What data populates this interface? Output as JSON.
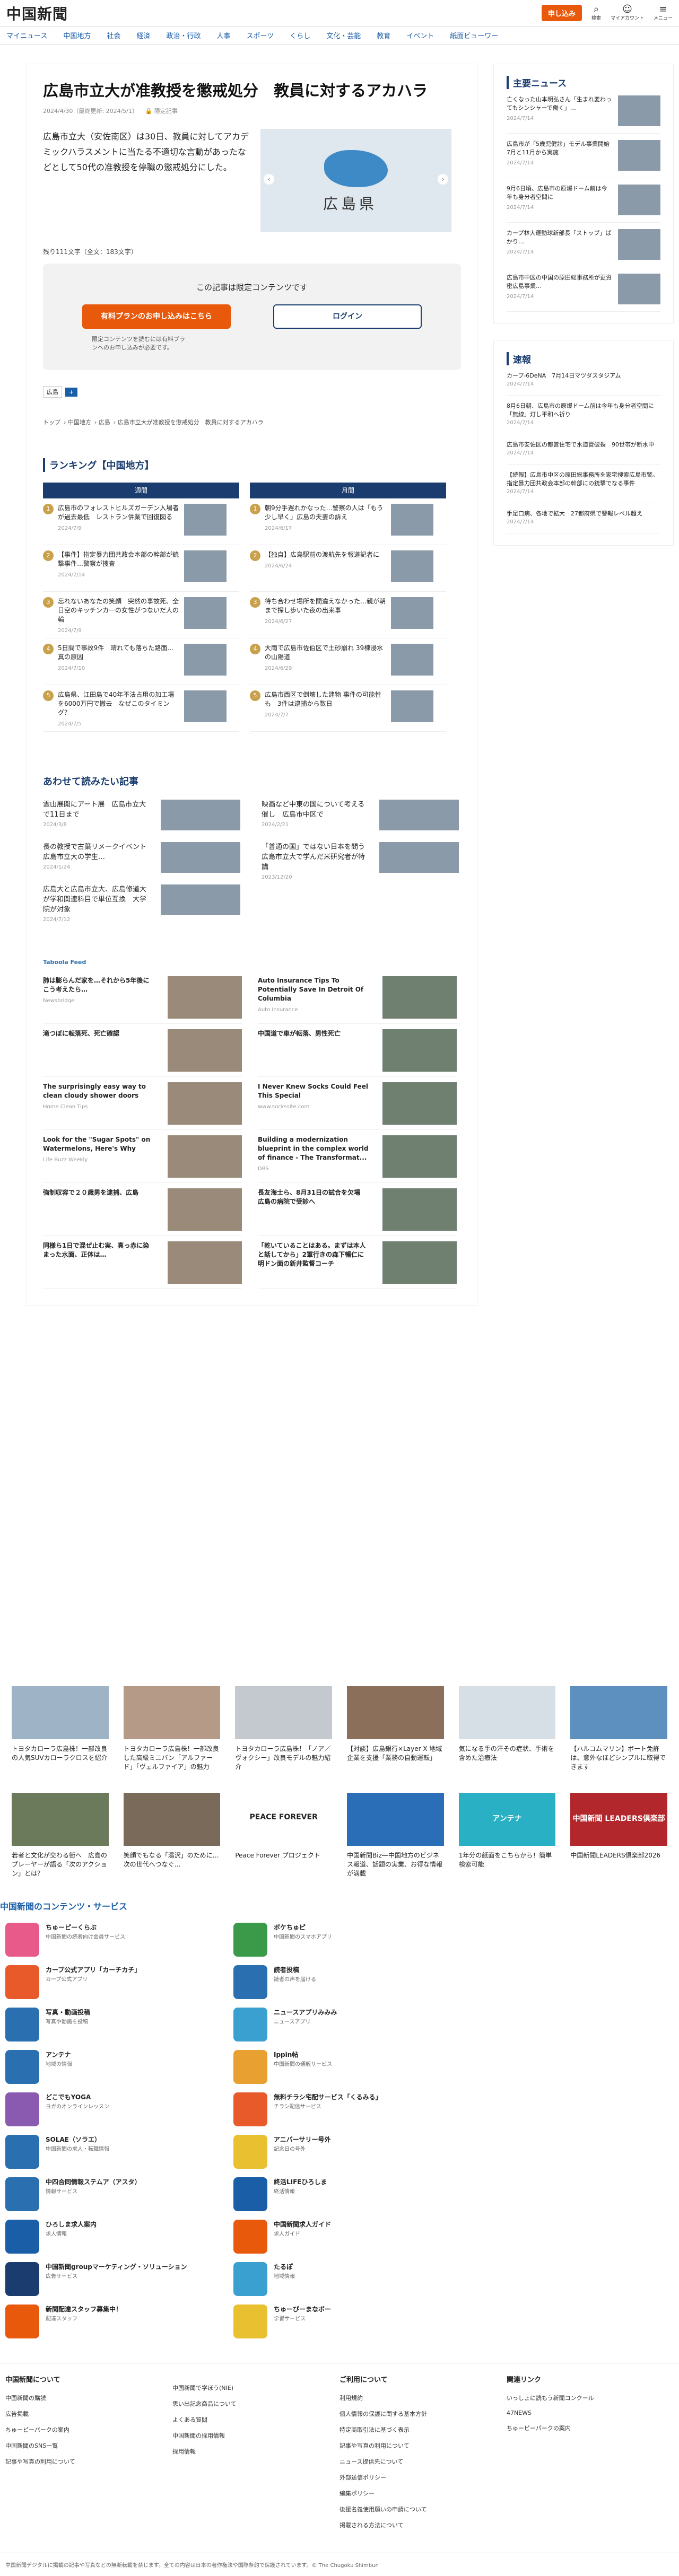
{
  "header": {
    "logo": "中国新聞",
    "signup": "申し込み",
    "search": "検索",
    "account": "マイアカウント",
    "menu": "メニュー"
  },
  "nav": [
    "マイニュース",
    "中国地方",
    "社会",
    "経済",
    "政治・行政",
    "人事",
    "スポーツ",
    "くらし",
    "文化・芸能",
    "教育",
    "イベント",
    "紙面ビューワー"
  ],
  "article": {
    "title": "広島市立大が准教授を懲戒処分　教員に対するアカハラ",
    "date": "2024/4/30（最終更新: 2024/5/1）",
    "limited": "限定記事",
    "lead": "広島市立大（安佐南区）は30日、教員に対してアカデミックハラスメントに当たる不適切な言動があったなどとして50代の准教授を停職の懲戒処分にした。",
    "map_label": "広島県",
    "chars": "残り111文字（全文：183文字）",
    "limited_heading": "この記事は限定コンテンツです",
    "plan_button": "有料プランのお申し込みはこちら",
    "login_button": "ログイン",
    "note": "限定コンテンツを読むには有料プランへのお申し込みが必要です。",
    "tag": "広島",
    "breadcrumb": [
      "トップ",
      "中国地方",
      "広島",
      "広島市立大が准教授を懲戒処分　教員に対するアカハラ"
    ]
  },
  "ranking": {
    "title": "ランキング【中国地方】",
    "weekly": "週間",
    "monthly": "月間",
    "weekly_items": [
      {
        "t": "広島市のフォレストヒルズガーデン入場者が過去最低　レストラン併業で回復図る",
        "d": "2024/7/9"
      },
      {
        "t": "【事件】指定暴力団共政会本部の幹部が銃撃事件…警察が捜査",
        "d": "2024/7/14"
      },
      {
        "t": "忘れないあなたの笑顔　突然の事故死、全日空のキッチンカーの女性がつないだ人の輪",
        "d": "2024/7/9"
      },
      {
        "t": "5日間で事故9件　晴れても落ちた路面…真の原因",
        "d": "2024/7/10"
      },
      {
        "t": "広島県、江田島で40年不法占用の加工場を6000万円で撤去　なぜこのタイミング？",
        "d": "2024/7/5"
      }
    ],
    "monthly_items": [
      {
        "t": "朝9分手遅れかなった…警察の人は「もう少し早く」広島の夫妻の訴え",
        "d": "2024/6/17"
      },
      {
        "t": "【独自】広島駅前の渡航先を報道記者に",
        "d": "2024/6/24"
      },
      {
        "t": "待ち合わせ場所を間違えなかった…親が朝まで探し歩いた夜の出来事",
        "d": "2024/6/27"
      },
      {
        "t": "大雨で広島市佐伯区で土砂崩れ 39棟浸水の山陽道",
        "d": "2024/6/29"
      },
      {
        "t": "広島市西区で倒壊した建物 事件の可能性も　3件は逮捕から数日",
        "d": "2024/7/7"
      }
    ]
  },
  "related": {
    "title": "あわせて読みたい記事",
    "items": [
      {
        "t": "霊山展開にアート展　広島市立大で11日まで",
        "d": "2024/3/8"
      },
      {
        "t": "映画など中東の国について考える催し　広島市中区で",
        "d": "2024/2/21"
      },
      {
        "t": "長の教授で古葉リメークイベント広島市立大の学生…",
        "d": "2024/1/24"
      },
      {
        "t": "「普通の国」ではない日本を問う　広島市立大で学んだ米研究者が特講",
        "d": "2023/12/20"
      },
      {
        "t": "広島大と広島市立大、広島修道大が学和関連科目で単位互換　大学院が対象",
        "d": "2024/7/12"
      }
    ]
  },
  "taboola": {
    "logo": "Taboola Feed",
    "items": [
      {
        "t": "肺は膨らんだ家を…それから5年後にこう考えたら…",
        "s": "Newsbridge"
      },
      {
        "t": "Auto Insurance Tips To Potentially Save In Detroit Of Columbia",
        "s": "Auto Insurance"
      },
      {
        "t": "滝つぼに転落死、死亡確認",
        "s": ""
      },
      {
        "t": "中国道で車が転落、男性死亡",
        "s": ""
      },
      {
        "t": "The surprisingly easy way to clean cloudy shower doors",
        "s": "Home Clean Tips"
      },
      {
        "t": "I Never Knew Socks Could Feel This Special",
        "s": "www.sockssite.com"
      },
      {
        "t": "Look for the \"Sugar Spots\" on Watermelons, Here's Why",
        "s": "Life Buzz Weekly"
      },
      {
        "t": "Building a modernization blueprint in the complex world of finance - The Transformat...",
        "s": "DBS"
      },
      {
        "t": "強制収容で２０歳男を逮捕、広島",
        "s": ""
      },
      {
        "t": "長友海士ら、8月31日の試合を欠場　広島の病院で受診へ",
        "s": ""
      },
      {
        "t": "同様ら1日で混ぜ止む実、真っ赤に染まった水面、正体は…",
        "s": ""
      },
      {
        "t": "「乾いていることはある。まずは本人と話してから」2軍行きの森下暢仁に明ドン面の新井監督コーチ",
        "s": ""
      }
    ]
  },
  "side": {
    "main_news_title": "主要ニュース",
    "main_news": [
      {
        "t": "亡くなった山本明弘さん「生まれ変わってもシンシャーで働く」…",
        "d": "2024/7/14"
      },
      {
        "t": "広島市が「5歳児健診」モデル事業開始　7月と11月から実施",
        "d": "2024/7/14"
      },
      {
        "t": "9月6日頃、広島市の原爆ドーム前は今年も身分者空間に　",
        "d": "2024/7/14"
      },
      {
        "t": "カープ林大運動球新部長「ストップ」ばかり…",
        "d": "2024/7/14"
      },
      {
        "t": "広島市中区の中国の原田総事務所が更資密広島事業…",
        "d": "2024/7/14"
      }
    ],
    "flash_title": "速報",
    "flash": [
      {
        "t": "カープ-6DeNA　7月14日マツダスタジアム",
        "d": "2024/7/14"
      },
      {
        "t": "8月6日朝、広島市の原爆ドーム前は今年も身分者空間に「無線」灯し平和へ祈り",
        "d": "2024/7/14"
      },
      {
        "t": "広島市安佐区の都営住宅で水道管破裂　90世帯が断水中",
        "d": "2024/7/14"
      },
      {
        "t": "【続報】広島市中区の原田総事務所を家宅捜索広島市警。指定暴力団共政会本部の幹部にの銃撃でなる事件",
        "d": "2024/7/14"
      },
      {
        "t": "手足口病、各地で拡大　27都府県で警報レベル超え",
        "d": "2024/7/14"
      }
    ]
  },
  "banners": [
    {
      "t": "トヨタカローラ広島株！一部改良の人気SUVカローラクロスを紹介"
    },
    {
      "t": "トヨタカローラ広島株！一部改良した高級ミニバン「アルファード」「ヴェルファイア」の魅力"
    },
    {
      "t": "トヨタカローラ広島株！「ノア／ヴォクシー」改良モデルの魅力紹介"
    },
    {
      "t": "【対談】広島銀行×Layer X 地域企業を支援「業務の自動運転」"
    },
    {
      "t": "気になる手の汗その症状、手術を含めた治療法"
    },
    {
      "t": "【ハルコムマリン】ボート免許は、意外なほどシンプルに取得できます"
    },
    {
      "t": "若者と文化が交わる街へ　広島のプレーヤーが語る「次のアクション」とは？"
    },
    {
      "t": "笑顔でもなる「湯沢」のために…次の世代へつなぐ…"
    },
    {
      "t": "Peace Forever プロジェクト"
    },
    {
      "t": "中国新聞Biz―中国地方のビジネス報道、話題の実業、お得な情報が満載"
    },
    {
      "t": "1年分の紙面をこちらから！簡単検索可能"
    },
    {
      "t": "中国新聞LEADERS倶楽部2026"
    }
  ],
  "banner_labels": {
    "peace": "PEACE FOREVER",
    "antena": "アンテナ",
    "leaders": "中国新聞 LEADERS倶楽部"
  },
  "services": {
    "title": "中国新聞のコンテンツ・サービス",
    "items": [
      {
        "n": "ちゅーピーくらぶ",
        "s": "中国新聞の読者向け会員サービス"
      },
      {
        "n": "ボケちゅピ",
        "s": "中国新聞のスマホアプリ"
      },
      {
        "n": "カープ公式アプリ「カーチカチ」",
        "s": "カープ公式アプリ"
      },
      {
        "n": "読者投稿",
        "s": "読者の声を届ける"
      },
      {
        "n": "写真・動画投稿",
        "s": "写真や動画を投稿"
      },
      {
        "n": "ニュースアプリみみみ",
        "s": "ニュースアプリ"
      },
      {
        "n": "アンテナ",
        "s": "地域の情報"
      },
      {
        "n": "Ippin帖",
        "s": "中国新聞の通販サービス"
      },
      {
        "n": "どこでもYOGA",
        "s": "ヨガのオンラインレッスン"
      },
      {
        "n": "無料チラシ宅配サービス「くるみる」",
        "s": "チラシ配信サービス"
      },
      {
        "n": "SOLAE（ソラエ）",
        "s": "中国新聞の求人・転職情報"
      },
      {
        "n": "アニバーサリー号外",
        "s": "記念日の号外"
      },
      {
        "n": "中四合同情報ステムア（アスタ）",
        "s": "情報サービス"
      },
      {
        "n": "終活LIFEひろしま",
        "s": "終活情報"
      },
      {
        "n": "ひろしま求人案内",
        "s": "求人情報"
      },
      {
        "n": "中国新聞求人ガイド",
        "s": "求人ガイド"
      },
      {
        "n": "中国新聞groupマーケティング・ソリューション",
        "s": "広告サービス"
      },
      {
        "n": "たるぽ",
        "s": "地域情報"
      },
      {
        "n": "新聞配達スタッフ募集中！",
        "s": "配達スタッフ"
      },
      {
        "n": "ちゅーぴーまなボー",
        "s": "学習サービス"
      }
    ]
  },
  "footer": {
    "cols": [
      {
        "h": "中国新聞について",
        "l": [
          "中国新聞の購読",
          "広告掲載",
          "ちゅーピーパークの案内",
          "中国新聞のSNS一覧",
          "記事や写真の利用について"
        ]
      },
      {
        "h": "",
        "l": [
          "中国新聞で学ぼう(NIE)",
          "思い出記念商品について",
          "よくある質問",
          "中国新聞の採用情報",
          "採用情報"
        ]
      },
      {
        "h": "ご利用について",
        "l": [
          "利用規約",
          "個人情報の保護に関する基本方針",
          "特定商取引法に基づく表示",
          "記事や写真の利用について",
          "ニュース提供先について",
          "外部送信ポリシー",
          "編集ポリシー",
          "後援名義使用願いの申請について",
          "掲載される方法について"
        ]
      },
      {
        "h": "関連リンク",
        "l": [
          "いっしょに読もう新聞コンクール",
          "47NEWS",
          "ちゅーピーパークの案内"
        ]
      }
    ],
    "copyright": "中国新聞デジタルに掲載の記事や写真などの無断転載を禁じます。全ての内容は日本の著作権法や国際条約で保護されています。© The Chugoku Shimbun"
  }
}
